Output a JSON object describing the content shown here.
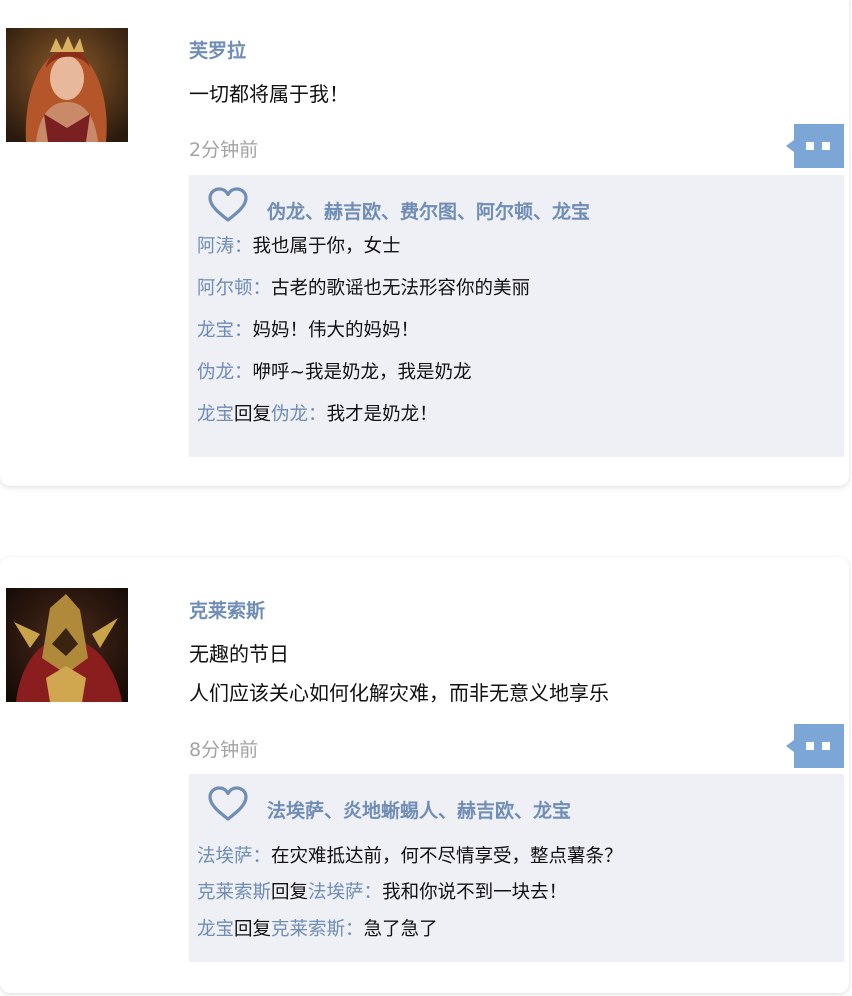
{
  "posts": [
    {
      "username": "芙罗拉",
      "content": [
        "一切都将属于我！"
      ],
      "timestamp": "2分钟前",
      "likes": "伪龙、赫吉欧、费尔图、阿尔顿、龙宝",
      "replies": [
        {
          "from": "阿涛",
          "to": "",
          "text": "我也属于你，女士"
        },
        {
          "from": "阿尔顿",
          "to": "",
          "text": "古老的歌谣也无法形容你的美丽"
        },
        {
          "from": "龙宝",
          "to": "",
          "text": "妈妈！伟大的妈妈！"
        },
        {
          "from": "伪龙",
          "to": "",
          "text": "咿呼~我是奶龙，我是奶龙"
        },
        {
          "from": "龙宝",
          "to": "伪龙",
          "text": "我才是奶龙！"
        }
      ]
    },
    {
      "username": "克莱索斯",
      "content": [
        "无趣的节日",
        "人们应该关心如何化解灾难，而非无意义地享乐"
      ],
      "timestamp": "8分钟前",
      "likes": "法埃萨、炎地蜥蜴人、赫吉欧、龙宝",
      "replies": [
        {
          "from": "法埃萨",
          "to": "",
          "text": "在灾难抵达前，何不尽情享受，整点薯条？"
        },
        {
          "from": "克莱索斯",
          "to": "法埃萨",
          "text": "我和你说不到一块去！"
        },
        {
          "from": "龙宝",
          "to": "克莱索斯",
          "text": "急了急了"
        }
      ]
    }
  ],
  "ui": {
    "reply_word": "回复",
    "separator": "：",
    "accent_color": "#6f8db5",
    "box_color": "#eef0f6",
    "button_color": "#7ba6d6"
  }
}
